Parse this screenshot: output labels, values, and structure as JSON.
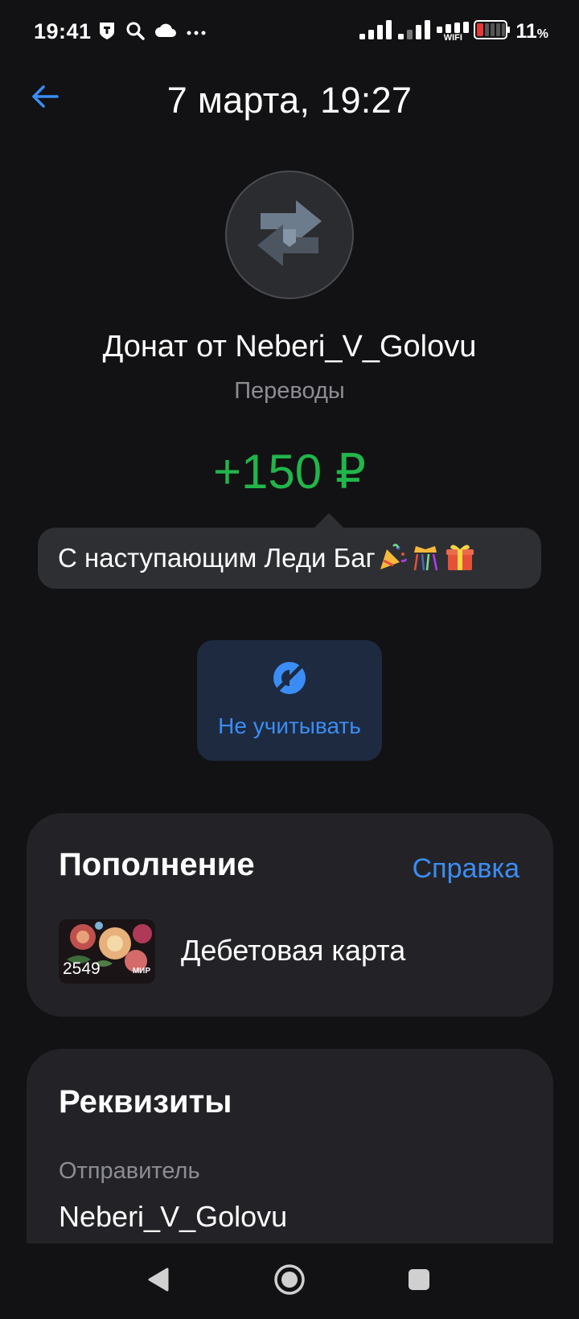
{
  "status_bar": {
    "time": "19:41",
    "left_icons": [
      "shield-notification-icon",
      "search-icon",
      "cloud-icon",
      "more-dots-icon"
    ],
    "wifi_label": "WIFI",
    "battery_percent": "11",
    "battery_unit": "%",
    "battery_level": 0.11
  },
  "header": {
    "title": "7 марта, 19:27",
    "back_icon": "arrow-left-icon"
  },
  "transaction": {
    "icon": "transfer-arrows-icon",
    "title": "Донат от Neberi_V_Golovu",
    "category": "Переводы",
    "amount": "+150 ₽",
    "comment": "С наступающим Леди Баг",
    "comment_emoji": [
      "party-popper-icon",
      "confetti-ball-icon",
      "gift-icon"
    ]
  },
  "actions": {
    "ignore_label": "Не учитывать",
    "ignore_icon": "eye-off-icon"
  },
  "deposit_card": {
    "title": "Пополнение",
    "help_label": "Справка",
    "card_last4": "2549",
    "card_brand": "МИР",
    "account_name": "Дебетовая карта"
  },
  "details_card": {
    "title": "Реквизиты",
    "sender_label": "Отправитель",
    "sender_value": "Neberi_V_Golovu"
  },
  "nav_bar": {
    "buttons": [
      "back-triangle-icon",
      "home-circle-icon",
      "recents-square-icon"
    ]
  },
  "colors": {
    "background": "#121214",
    "card": "#232327",
    "accent_blue": "#3b8df5",
    "amount_green": "#21b64a",
    "muted_text": "#8c8c94"
  }
}
